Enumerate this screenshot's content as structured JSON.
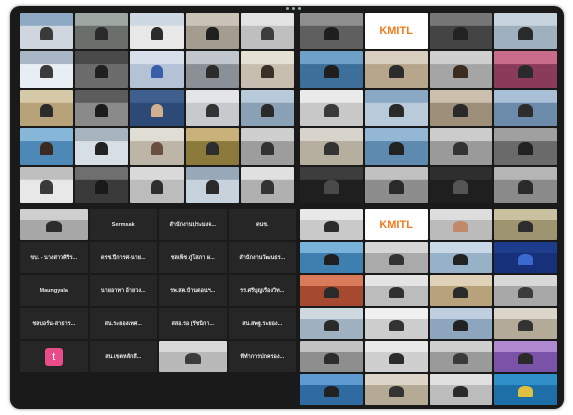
{
  "meeting": {
    "gallery_top_left": [
      {
        "label": "",
        "colors": [
          "#8ea9c4",
          "#cfd6dd",
          "#3a3a3a"
        ]
      },
      {
        "label": "",
        "colors": [
          "#9fa7a3",
          "#6b6f6b",
          "#2a2a2a"
        ]
      },
      {
        "label": "",
        "colors": [
          "#cdd8e2",
          "#e8e8e8",
          "#2b2b2b"
        ]
      },
      {
        "label": "",
        "colors": [
          "#c9c3b8",
          "#a39c8f",
          "#1f1f1f"
        ]
      },
      {
        "label": "",
        "colors": [
          "#e3e3e3",
          "#bfbfbf",
          "#3c3c3c"
        ]
      },
      {
        "label": "",
        "colors": [
          "#a8b6c6",
          "#e8eef3",
          "#3b3b3b"
        ]
      },
      {
        "label": "",
        "colors": [
          "#4a4a4a",
          "#6c6c6c",
          "#1f1f1f"
        ]
      },
      {
        "label": "",
        "colors": [
          "#d7dfea",
          "#b5c2d6",
          "#3b5ea8"
        ]
      },
      {
        "label": "",
        "colors": [
          "#c0c6cc",
          "#8a9096",
          "#2c2c2c"
        ]
      },
      {
        "label": "",
        "colors": [
          "#e5e0d4",
          "#c8beb0",
          "#3a3028"
        ]
      },
      {
        "label": "",
        "colors": [
          "#d6c9a8",
          "#b7a27a",
          "#2b2b2b"
        ]
      },
      {
        "label": "",
        "colors": [
          "#5c5c5c",
          "#8a8a8a",
          "#1b1b1b"
        ]
      },
      {
        "label": "",
        "colors": [
          "#3f5f8f",
          "#2c4a75",
          "#d0b090"
        ]
      },
      {
        "label": "",
        "colors": [
          "#e2e4e6",
          "#c7cacc",
          "#333333"
        ]
      },
      {
        "label": "",
        "colors": [
          "#b8c9d9",
          "#8aa1b5",
          "#2a2a2a"
        ]
      },
      {
        "label": "",
        "colors": [
          "#87b7d8",
          "#4e88b7",
          "#3a2a20"
        ]
      },
      {
        "label": "",
        "colors": [
          "#a7b4bf",
          "#d7dfe5",
          "#222222"
        ]
      },
      {
        "label": "",
        "colors": [
          "#e0ddd5",
          "#bdb6a8",
          "#6a5040"
        ]
      },
      {
        "label": "",
        "colors": [
          "#c8b27a",
          "#8c7a3c",
          "#2d2d2d"
        ]
      },
      {
        "label": "",
        "colors": [
          "#cfcfcf",
          "#9d9d9d",
          "#333333"
        ]
      },
      {
        "label": "",
        "colors": [
          "#bfbfbf",
          "#e8e8e8",
          "#3a3a3a"
        ]
      },
      {
        "label": "",
        "colors": [
          "#6f6f6f",
          "#3a3a3a",
          "#1a1a1a"
        ]
      },
      {
        "label": "",
        "colors": [
          "#dadada",
          "#bcbcbc",
          "#2d2d2d"
        ]
      },
      {
        "label": "",
        "colors": [
          "#98a8b8",
          "#c8d2dc",
          "#2a2a2a"
        ]
      },
      {
        "label": "",
        "colors": [
          "#e0e0e0",
          "#b0b0b0",
          "#333333"
        ]
      }
    ],
    "gallery_top_right": [
      {
        "label": "",
        "colors": [
          "#8f8f8f",
          "#5f5f5f",
          "#1e1e1e"
        ]
      },
      {
        "label": "KMITL",
        "colors": [
          "#ffffff",
          "#ffffff",
          "#f07a1c"
        ]
      },
      {
        "label": "",
        "colors": [
          "#777777",
          "#444444",
          "#222222"
        ]
      },
      {
        "label": "",
        "colors": [
          "#c7d3dd",
          "#9fb0bf",
          "#2a2a2a"
        ]
      },
      {
        "label": "",
        "colors": [
          "#6fa0c8",
          "#3e6f9a",
          "#1f1f1f"
        ]
      },
      {
        "label": "",
        "colors": [
          "#d9cfc0",
          "#b8a68c",
          "#2c2c2c"
        ]
      },
      {
        "label": "",
        "colors": [
          "#cfcfcf",
          "#a5a5a5",
          "#3c2c20"
        ]
      },
      {
        "label": "",
        "colors": [
          "#c96b8a",
          "#8a3b5a",
          "#2a2a2a"
        ]
      },
      {
        "label": "",
        "colors": [
          "#eaeaea",
          "#c8c8c8",
          "#3a3a3a"
        ]
      },
      {
        "label": "",
        "colors": [
          "#8aa8c4",
          "#b9cadb",
          "#2a2a2a"
        ]
      },
      {
        "label": "",
        "colors": [
          "#cbbfae",
          "#9d8f7a",
          "#2a2a2a"
        ]
      },
      {
        "label": "",
        "colors": [
          "#a9bfd6",
          "#6c8bab",
          "#2d2d2d"
        ]
      },
      {
        "label": "",
        "colors": [
          "#d8d4cc",
          "#b6ae9f",
          "#333333"
        ]
      },
      {
        "label": "",
        "colors": [
          "#93b7d4",
          "#5f8ab0",
          "#222222"
        ]
      },
      {
        "label": "",
        "colors": [
          "#cccccc",
          "#9a9a9a",
          "#333333"
        ]
      },
      {
        "label": "",
        "colors": [
          "#a0a0a0",
          "#6a6a6a",
          "#222222"
        ]
      },
      {
        "label": "",
        "colors": [
          "#3d3d3d",
          "#1f1f1f",
          "#4a4a4a"
        ]
      },
      {
        "label": "",
        "colors": [
          "#c1c1c1",
          "#8d8d8d",
          "#2a2a2a"
        ]
      },
      {
        "label": "",
        "colors": [
          "#2e2e2e",
          "#1f1f1f",
          "#555555"
        ]
      },
      {
        "label": "",
        "colors": [
          "#b5b5b5",
          "#8a8a8a",
          "#2a2a2a"
        ]
      }
    ],
    "name_tiles": [
      {
        "name": "",
        "sub": "",
        "video": true,
        "colors": [
          "#cfcfcf",
          "#a7a7a7",
          "#2c2c2c"
        ]
      },
      {
        "name": "Sermsak",
        "sub": ""
      },
      {
        "name": "สำนักงานประมงจ...",
        "sub": ""
      },
      {
        "name": "ดนช.",
        "sub": ""
      },
      {
        "name": "ขบ. - นางสาวศิริร...",
        "sub": ""
      },
      {
        "name": "ดรช.ปีการศ-นาย...",
        "sub": ""
      },
      {
        "name": "ชลเพ็ช ภู่โสภา ผ...",
        "sub": ""
      },
      {
        "name": "สำนักงานวัฒนธร...",
        "sub": ""
      },
      {
        "name": "Maungyala",
        "sub": ""
      },
      {
        "name": "นายอาทา อ้ายวง...",
        "sub": ""
      },
      {
        "name": "รพ.สต.บ้านดอนฯ...",
        "sub": ""
      },
      {
        "name": "รร.ศรีบุญเรืองวิท...",
        "sub": ""
      },
      {
        "name": "ชลบอร์น-สาธาร...",
        "sub": ""
      },
      {
        "name": "สน.ระยองเทศ...",
        "sub": ""
      },
      {
        "name": "สสอ.รอ (รัชนิกา...",
        "sub": ""
      },
      {
        "name": "สน.สพฐ.ระยอง...",
        "sub": ""
      },
      {
        "name": "t",
        "sub": "",
        "avatar": true
      },
      {
        "name": "สน.เขตหลักสี่...",
        "sub": ""
      },
      {
        "name": "",
        "sub": "",
        "video": true,
        "colors": [
          "#d9d9d9",
          "#b9b9b9",
          "#3c3c3c"
        ]
      },
      {
        "name": "ที่ทำการปกครอง...",
        "sub": ""
      }
    ],
    "gallery_bottom_right": [
      {
        "label": "",
        "colors": [
          "#e8e8e8",
          "#c9c9c9",
          "#2c2c2c"
        ]
      },
      {
        "label": "KMITL",
        "colors": [
          "#ffffff",
          "#ffffff",
          "#f07a1c"
        ]
      },
      {
        "label": "",
        "colors": [
          "#dddddd",
          "#bbbbbb",
          "#c08a6a"
        ]
      },
      {
        "label": "",
        "colors": [
          "#c9c1a0",
          "#9e9470",
          "#2d2d2d"
        ]
      },
      {
        "label": "",
        "colors": [
          "#79b2d9",
          "#3f7fb0",
          "#1f1f1f"
        ]
      },
      {
        "label": "",
        "colors": [
          "#d6d6d6",
          "#aaaaaa",
          "#333333"
        ]
      },
      {
        "label": "",
        "colors": [
          "#c9d8e6",
          "#97b1c8",
          "#222222"
        ]
      },
      {
        "label": "",
        "colors": [
          "#1e3c8c",
          "#16307a",
          "#3a6ad0"
        ]
      },
      {
        "label": "",
        "colors": [
          "#d97a5a",
          "#a54a30",
          "#2a2a2a"
        ]
      },
      {
        "label": "",
        "colors": [
          "#e4e4e4",
          "#bcbcbc",
          "#303030"
        ]
      },
      {
        "label": "",
        "colors": [
          "#e0d2b8",
          "#b7a27c",
          "#2a2a2a"
        ]
      },
      {
        "label": "",
        "colors": [
          "#d8d8d8",
          "#a8a8a8",
          "#3c3c3c"
        ]
      },
      {
        "label": "",
        "colors": [
          "#cfd7df",
          "#9fb0c0",
          "#2a2a2a"
        ]
      },
      {
        "label": "",
        "colors": [
          "#f0f0f0",
          "#cdcdcd",
          "#333333"
        ]
      },
      {
        "label": "",
        "colors": [
          "#bfcfdf",
          "#8ea6bd",
          "#222222"
        ]
      },
      {
        "label": "",
        "colors": [
          "#dcd6ca",
          "#b4aa98",
          "#333333"
        ]
      },
      {
        "label": "",
        "colors": [
          "#c2c2c2",
          "#8e8e8e",
          "#2d2d2d"
        ]
      },
      {
        "label": "",
        "colors": [
          "#e9e9e9",
          "#cfcfcf",
          "#2c2c2c"
        ]
      },
      {
        "label": "",
        "colors": [
          "#cfcfcf",
          "#9a9a9a",
          "#3a3a3a"
        ]
      },
      {
        "label": "",
        "colors": [
          "#b08ad0",
          "#7a52a8",
          "#2a2a2a"
        ]
      },
      {
        "label": "",
        "colors": [
          "#5f9ad1",
          "#2f6aa1",
          "#222222"
        ]
      },
      {
        "label": "",
        "colors": [
          "#ddd6c8",
          "#b5aa96",
          "#333333"
        ]
      },
      {
        "label": "",
        "colors": [
          "#e0e0e0",
          "#bcbcbc",
          "#2a2a2a"
        ]
      },
      {
        "label": "",
        "colors": [
          "#2f8fc8",
          "#1e6fa8",
          "#e0c040"
        ]
      }
    ]
  }
}
